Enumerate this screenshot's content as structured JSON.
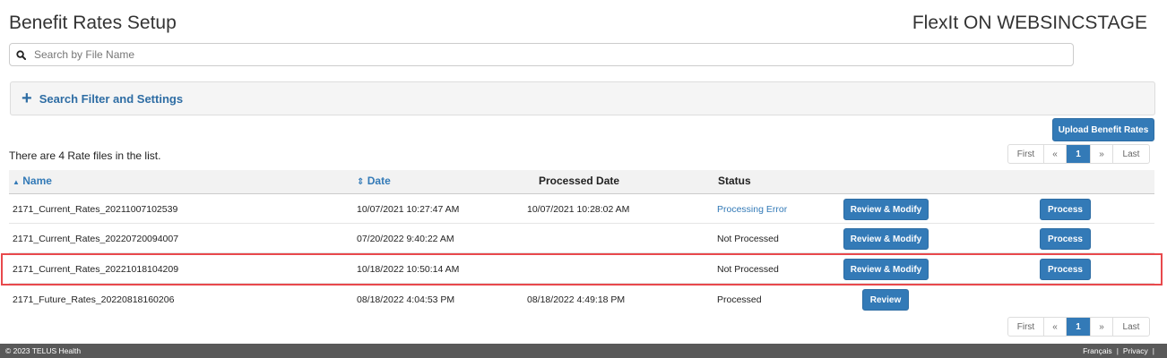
{
  "header": {
    "title": "Benefit Rates Setup",
    "app_name": "FlexIt ON WEBSINCSTAGE"
  },
  "search": {
    "placeholder": "Search by File Name",
    "value": ""
  },
  "filter_panel": {
    "icon": "plus-icon",
    "label": "Search Filter and Settings"
  },
  "toolbar": {
    "upload_label": "Upload Benefit Rates"
  },
  "summary": {
    "count_text": "There are 4 Rate files in the list."
  },
  "pagination": {
    "first": "First",
    "prev": "«",
    "current": "1",
    "next": "»",
    "last": "Last"
  },
  "table": {
    "columns": {
      "name": "Name",
      "date": "Date",
      "processed_date": "Processed Date",
      "status": "Status"
    },
    "sort_icons": {
      "name": "▲",
      "date": "⇕"
    },
    "rows": [
      {
        "name": "2171_Current_Rates_20211007102539",
        "date": "10/07/2021 10:27:47 AM",
        "processed_date": "10/07/2021 10:28:02 AM",
        "status": "Processing Error",
        "review_label": "Review & Modify",
        "process_label": "Process"
      },
      {
        "name": "2171_Current_Rates_20220720094007",
        "date": "07/20/2022 9:40:22 AM",
        "processed_date": "",
        "status": "Not Processed",
        "review_label": "Review & Modify",
        "process_label": "Process"
      },
      {
        "name": "2171_Current_Rates_20221018104209",
        "date": "10/18/2022 10:50:14 AM",
        "processed_date": "",
        "status": "Not Processed",
        "review_label": "Review & Modify",
        "process_label": "Process"
      },
      {
        "name": "2171_Future_Rates_20220818160206",
        "date": "08/18/2022 4:04:53 PM",
        "processed_date": "08/18/2022 4:49:18 PM",
        "status": "Processed",
        "review_label": "Review"
      }
    ]
  },
  "footer": {
    "copyright": "© 2023 TELUS Health",
    "lang_link": "Français",
    "separator": "|",
    "privacy_link": "Privacy",
    "trailing_separator": "|"
  },
  "colors": {
    "accent": "#337ab7",
    "highlight": "#e8494c",
    "footer_bg": "#595959"
  }
}
